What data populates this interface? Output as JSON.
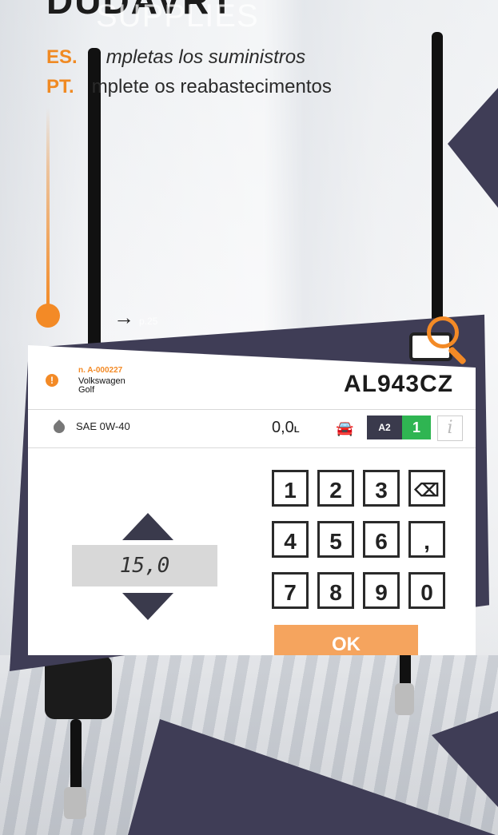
{
  "header": {
    "title": "DUDAVRT",
    "ghost_title": "SUPPLIES",
    "es_code": "ES.",
    "es_text": "mpletas los suministros",
    "pt_code": "PT.",
    "pt_text": "mplete os reabastecimentos",
    "next_arrow": "→",
    "next_page": "p.25"
  },
  "colors": {
    "accent": "#f38a26",
    "frame": "#3f3d56",
    "green": "#2fb552"
  },
  "ticket": {
    "warning_glyph": "!",
    "order_number": "n. A-000227",
    "make": "Volkswagen",
    "model": "Golf",
    "plate": "AL943CZ"
  },
  "supply": {
    "oil_type": "SAE 0W-40",
    "quantity": "0,0",
    "unit": "L",
    "car_icon": "car-lift-icon",
    "badge_a2": "A2",
    "badge_count": "1",
    "info_glyph": "i"
  },
  "stepper": {
    "value": "15,0"
  },
  "keypad": {
    "keys": [
      "1",
      "2",
      "3",
      "⌫",
      "4",
      "5",
      "6",
      ",",
      "7",
      "8",
      "9",
      "0"
    ],
    "ok_label": "OK"
  }
}
